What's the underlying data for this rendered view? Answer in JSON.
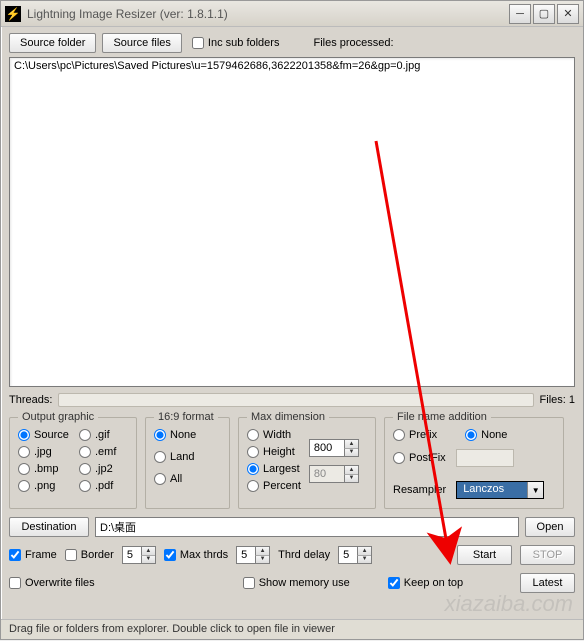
{
  "title": "Lightning Image Resizer (ver: 1.8.1.1)",
  "toolbar": {
    "source_folder": "Source folder",
    "source_files": "Source files",
    "inc_sub": "Inc sub folders",
    "files_processed_label": "Files processed:"
  },
  "list_items": [
    "C:\\Users\\pc\\Pictures\\Saved Pictures\\u=1579462686,3622201358&fm=26&gp=0.jpg"
  ],
  "threads": {
    "label": "Threads:",
    "files_text": "Files: 1"
  },
  "output_graphic": {
    "legend": "Output graphic",
    "source": "Source",
    "gif": ".gif",
    "jpg": ".jpg",
    "emf": ".emf",
    "bmp": ".bmp",
    "jp2": ".jp2",
    "png": ".png",
    "pdf": ".pdf"
  },
  "ratio": {
    "legend": "16:9 format",
    "none": "None",
    "land": "Land",
    "all": "All"
  },
  "maxdim": {
    "legend": "Max dimension",
    "width": "Width",
    "height": "Height",
    "largest": "Largest",
    "percent": "Percent",
    "v1": "800",
    "v2": "80"
  },
  "fname": {
    "legend": "File name addition",
    "prefix": "Prefix",
    "none": "None",
    "postfix": "PostFix",
    "resampler_label": "Resampler",
    "resampler_value": "Lanczos"
  },
  "dest": {
    "btn": "Destination",
    "path": "D:\\桌面",
    "open": "Open"
  },
  "opts": {
    "frame": "Frame",
    "border": "Border",
    "frame_val": "5",
    "max_thrds": "Max thrds",
    "max_thrds_val": "5",
    "thrd_delay": "Thrd delay",
    "thrd_delay_val": "5",
    "start": "Start",
    "stop": "STOP",
    "overwrite": "Overwrite files",
    "show_mem": "Show memory use",
    "keep_on_top": "Keep on top",
    "latest": "Latest"
  },
  "status": "Drag file or folders from explorer.  Double click to open file in viewer"
}
